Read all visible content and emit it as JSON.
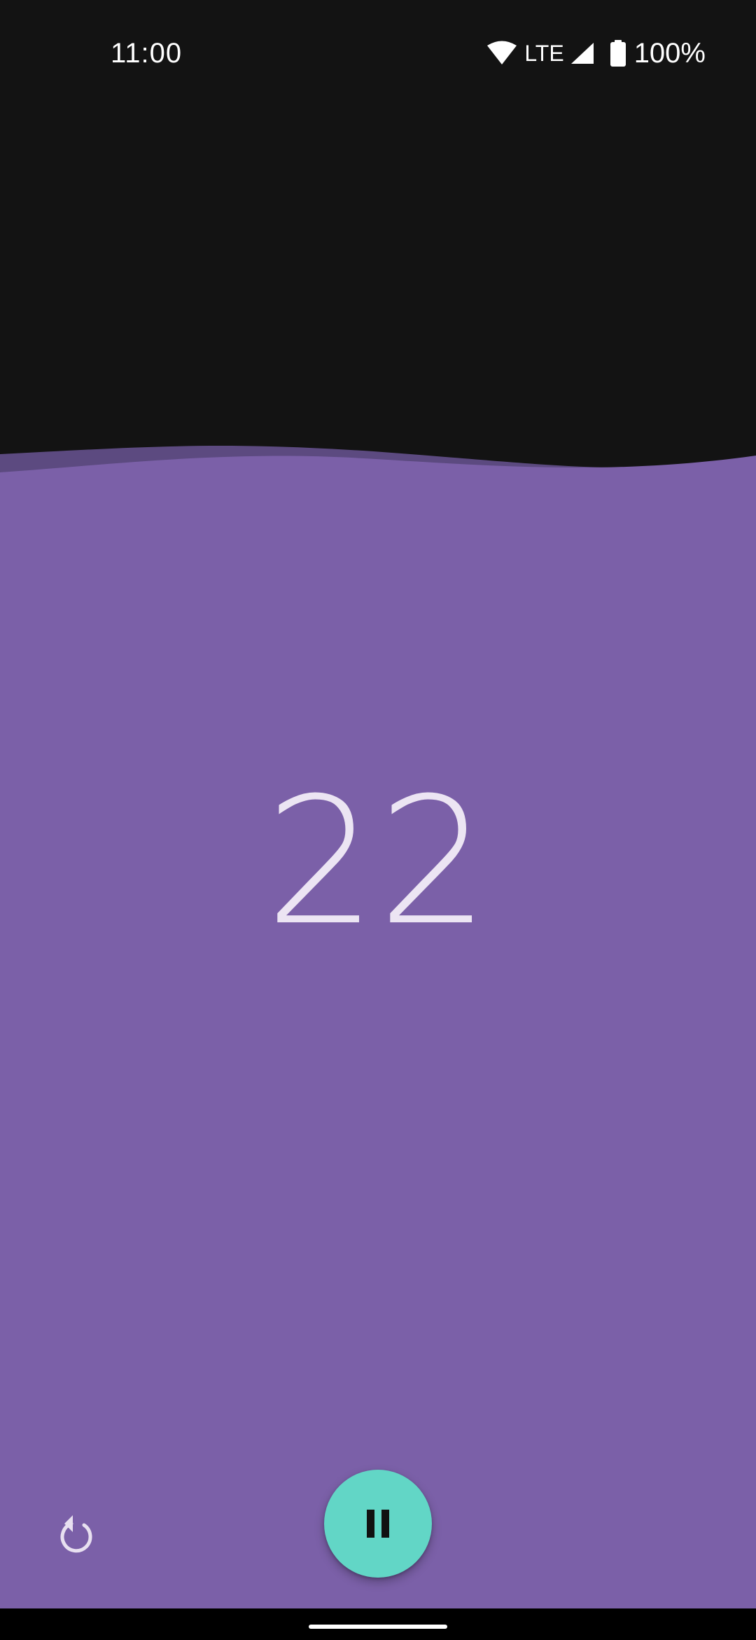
{
  "status_bar": {
    "time": "11:00",
    "network": "LTE",
    "battery": "100%",
    "icons": [
      "wifi-icon",
      "signal-icon",
      "battery-icon"
    ]
  },
  "timer": {
    "value": "22"
  },
  "controls": {
    "reset_icon": "reset-icon",
    "pause_icon": "pause-icon"
  },
  "colors": {
    "background": "#131313",
    "water": "#7b60a8",
    "wave_back": "#5c4a80",
    "counter_text": "#ece5f3",
    "fab": "#62d6c6",
    "fab_icon": "#111111"
  }
}
